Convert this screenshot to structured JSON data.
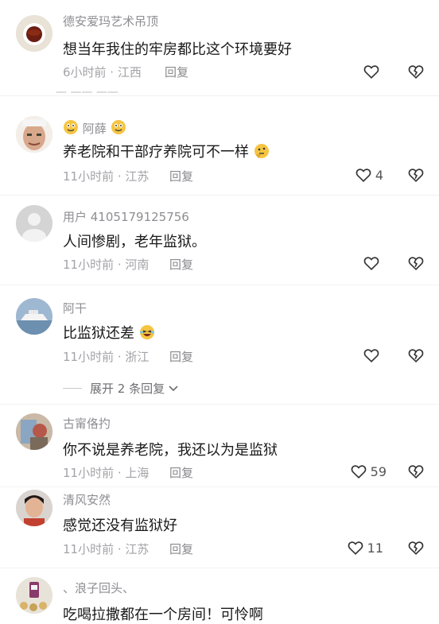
{
  "comments": [
    {
      "username": "德安爱玛艺术吊顶",
      "text": "想当年我住的牢房都比这个环境要好",
      "meta": "6小时前 · 江西",
      "reply": "回复",
      "likes": ""
    },
    {
      "username": "阿薛",
      "text": "养老院和干部疗养院可不一样",
      "meta": "11小时前 · 江苏",
      "reply": "回复",
      "likes": "4"
    },
    {
      "username": "用户 4105179125756",
      "text": "人间惨剧，老年监狱。",
      "meta": "11小时前 · 河南",
      "reply": "回复",
      "likes": ""
    },
    {
      "username": "阿干",
      "text": "比监狱还差",
      "meta": "11小时前 · 浙江",
      "reply": "回复",
      "likes": ""
    },
    {
      "username": "古甯佫扚",
      "text": "你不说是养老院，我还以为是监狱",
      "meta": "11小时前 · 上海",
      "reply": "回复",
      "likes": "59"
    },
    {
      "username": "清风安然",
      "text": "感觉还没有监狱好",
      "meta": "11小时前 · 江苏",
      "reply": "回复",
      "likes": "11"
    },
    {
      "username": "、浪子回头、",
      "text": "吃喝拉撒都在一个房间！可怜啊",
      "meta": "",
      "reply": "",
      "likes": ""
    }
  ],
  "expand": {
    "label": "展开 2 条回复"
  },
  "icons": {
    "like": "heart-outline-icon",
    "dislike": "broken-heart-icon",
    "expand": "chevron-down-icon"
  },
  "colors": {
    "text": "#1a1a1a",
    "meta": "#a3a3a8",
    "username": "#8e8e93"
  }
}
